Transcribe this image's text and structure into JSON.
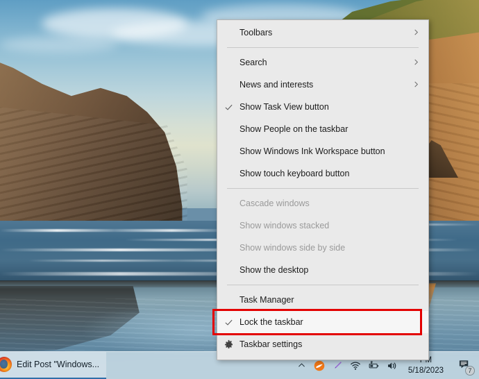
{
  "desktop": {
    "wallpaper_description": "coastal cliffs and sea arch at sunset reflected on wet sand",
    "accent_red": "#e30000",
    "menu_bg": "#eaeaea"
  },
  "context_menu": {
    "items": [
      {
        "label": "Toolbars",
        "checked": false,
        "disabled": false,
        "submenu": true,
        "icon": ""
      },
      {
        "type": "separator"
      },
      {
        "label": "Search",
        "checked": false,
        "disabled": false,
        "submenu": true,
        "icon": ""
      },
      {
        "label": "News and interests",
        "checked": false,
        "disabled": false,
        "submenu": true,
        "icon": ""
      },
      {
        "label": "Show Task View button",
        "checked": true,
        "disabled": false,
        "submenu": false,
        "icon": ""
      },
      {
        "label": "Show People on the taskbar",
        "checked": false,
        "disabled": false,
        "submenu": false,
        "icon": ""
      },
      {
        "label": "Show Windows Ink Workspace button",
        "checked": false,
        "disabled": false,
        "submenu": false,
        "icon": ""
      },
      {
        "label": "Show touch keyboard button",
        "checked": false,
        "disabled": false,
        "submenu": false,
        "icon": ""
      },
      {
        "type": "separator"
      },
      {
        "label": "Cascade windows",
        "checked": false,
        "disabled": true,
        "submenu": false,
        "icon": ""
      },
      {
        "label": "Show windows stacked",
        "checked": false,
        "disabled": true,
        "submenu": false,
        "icon": ""
      },
      {
        "label": "Show windows side by side",
        "checked": false,
        "disabled": true,
        "submenu": false,
        "icon": ""
      },
      {
        "label": "Show the desktop",
        "checked": false,
        "disabled": false,
        "submenu": false,
        "icon": ""
      },
      {
        "type": "separator"
      },
      {
        "label": "Task Manager",
        "checked": false,
        "disabled": false,
        "submenu": false,
        "icon": ""
      },
      {
        "label": "Lock the taskbar",
        "checked": true,
        "disabled": false,
        "submenu": false,
        "icon": "",
        "highlighted": true
      },
      {
        "label": "Taskbar settings",
        "checked": false,
        "disabled": false,
        "submenu": false,
        "icon": "gear-icon"
      }
    ],
    "checkmark_glyph": "✓",
    "submenu_glyph": "›"
  },
  "taskbar": {
    "task_button_label": "Edit Post \"Windows...",
    "task_button_icon": "firefox-icon",
    "tray": {
      "show_hidden_icons": "⌃",
      "icons": [
        {
          "name": "tray-overflow-chevron-icon",
          "glyph": "⌃"
        },
        {
          "name": "orange-app-icon",
          "glyph": ""
        },
        {
          "name": "pen-icon",
          "glyph": ""
        },
        {
          "name": "wifi-icon",
          "glyph": ""
        },
        {
          "name": "battery-icon",
          "glyph": ""
        },
        {
          "name": "volume-icon",
          "glyph": ""
        }
      ],
      "time": "PM",
      "date": "5/18/2023",
      "notification_count": "7"
    }
  }
}
